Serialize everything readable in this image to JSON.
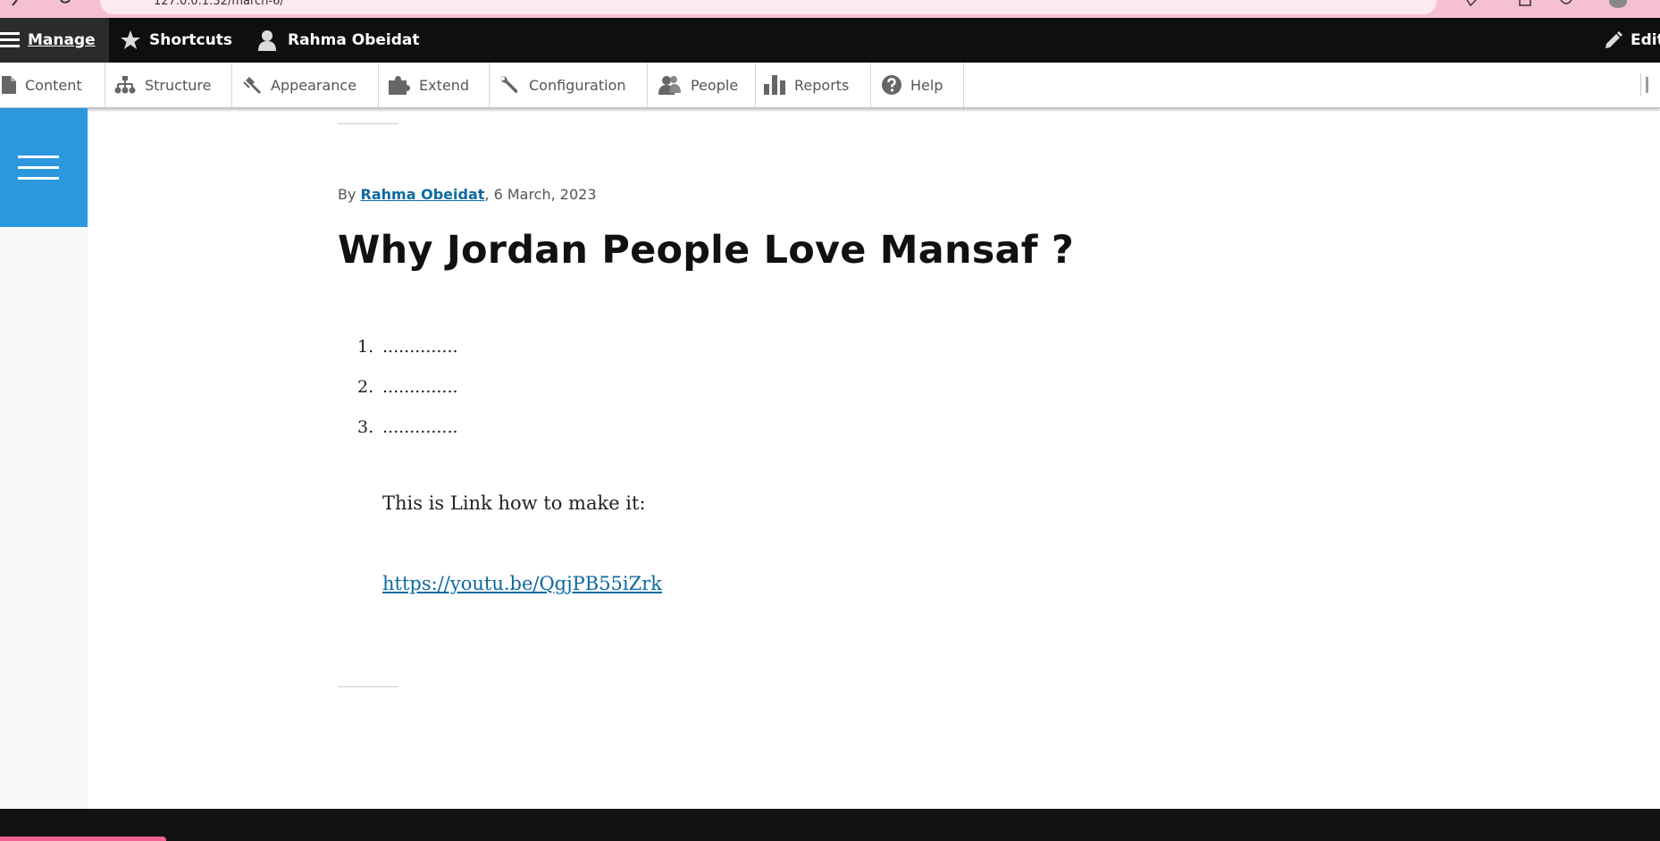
{
  "browser": {
    "url": "127.0.0.1:32/march-6/"
  },
  "toolbar": {
    "manage_label": "Manage",
    "shortcuts_label": "Shortcuts",
    "user_label": "Rahma Obeidat",
    "edit_label": "Edit"
  },
  "tray": {
    "items": [
      {
        "label": "Content",
        "icon": "file-icon"
      },
      {
        "label": "Structure",
        "icon": "sitemap-icon"
      },
      {
        "label": "Appearance",
        "icon": "paintbrush-icon"
      },
      {
        "label": "Extend",
        "icon": "puzzle-icon"
      },
      {
        "label": "Configuration",
        "icon": "wrench-icon"
      },
      {
        "label": "People",
        "icon": "people-icon"
      },
      {
        "label": "Reports",
        "icon": "bar-chart-icon"
      },
      {
        "label": "Help",
        "icon": "help-icon"
      }
    ]
  },
  "article": {
    "by": "By",
    "author": "Rahma Obeidat",
    "date": ", 6 March, 2023",
    "title": "Why Jordan People Love Mansaf ?",
    "list": [
      {
        "num": "1.",
        "text": ".............."
      },
      {
        "num": "2.",
        "text": ".............."
      },
      {
        "num": "3.",
        "text": ".............."
      }
    ],
    "body": "This is Link how to make it:",
    "link": "https://youtu.be/QgjPB55iZrk"
  },
  "colors": {
    "toolbar_bg": "#0f0f0f",
    "accent_blue": "#2b98de",
    "link": "#0b6aa2",
    "browser_pink": "#f6c0d4"
  }
}
